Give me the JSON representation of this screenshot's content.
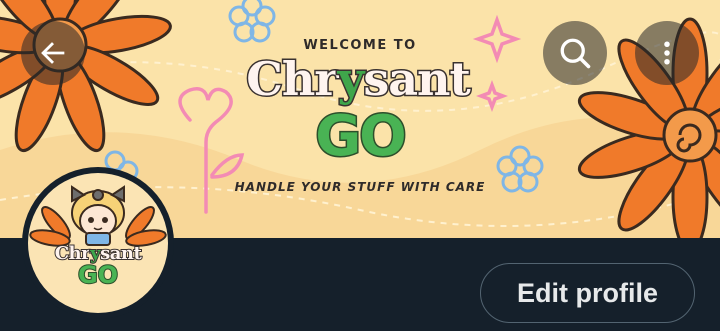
{
  "banner": {
    "welcome_text": "WELCOME TO",
    "brand_prefix": "Chr",
    "brand_y": "y",
    "brand_suffix": "sant",
    "go_text": "GO",
    "tagline": "HANDLE YOUR STUFF WITH CARE"
  },
  "avatar": {
    "brand_prefix": "Chr",
    "brand_y": "y",
    "brand_suffix": "sant",
    "go_text": "GO"
  },
  "actions": {
    "edit_profile_label": "Edit profile"
  },
  "icons": {
    "back": "arrow-left-icon",
    "search": "search-icon",
    "more": "more-vertical-icon"
  },
  "colors": {
    "banner_bg": "#fbe3a9",
    "flower_orange": "#f07a2a",
    "page_bg": "#15202b",
    "button_border": "#536471",
    "button_text": "#e7e9ea"
  }
}
